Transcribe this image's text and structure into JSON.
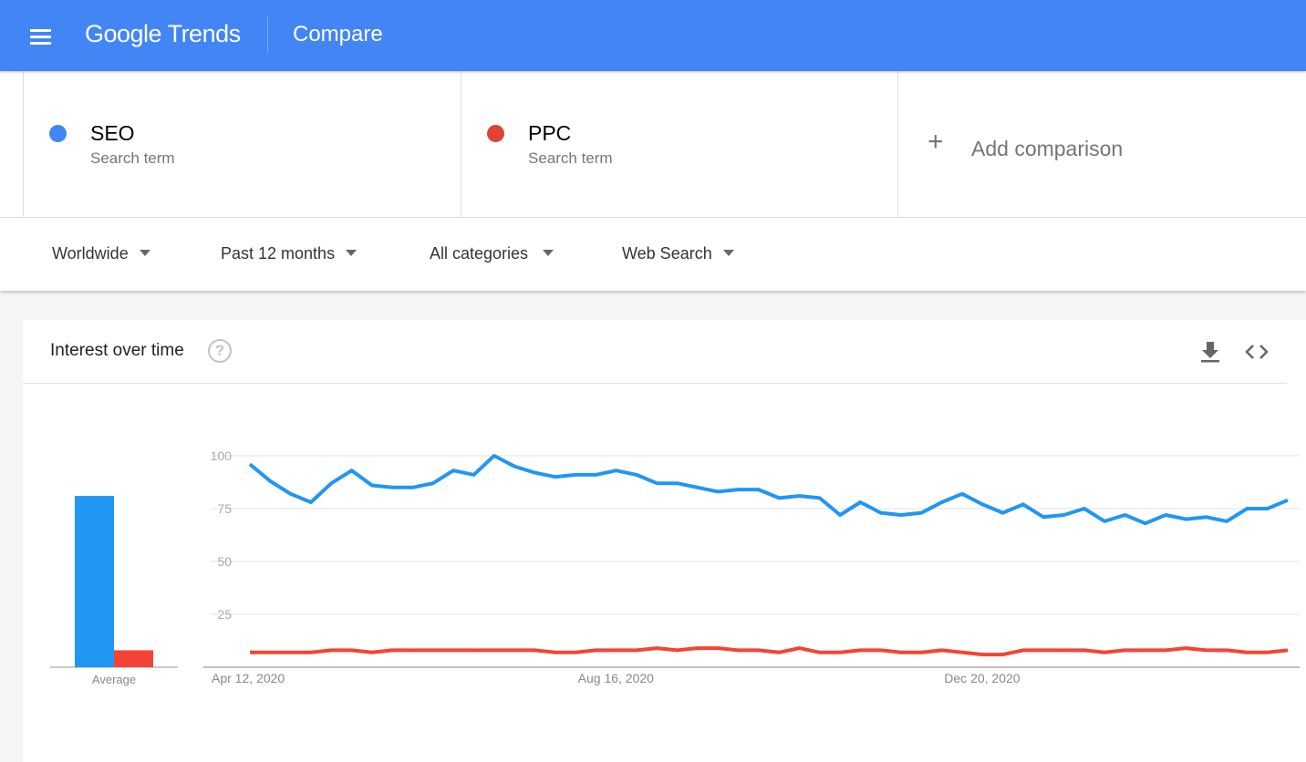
{
  "header": {
    "logo_text": "Google Trends",
    "page_title": "Compare",
    "brand_color": "#4285f4"
  },
  "terms": [
    {
      "name": "SEO",
      "type": "Search term",
      "color": "#4285f4"
    },
    {
      "name": "PPC",
      "type": "Search term",
      "color": "#db4437"
    }
  ],
  "add_comparison": {
    "icon": "plus-icon",
    "label": "Add comparison"
  },
  "filters": [
    {
      "label": "Worldwide"
    },
    {
      "label": "Past 12 months"
    },
    {
      "label": "All categories"
    },
    {
      "label": "Web Search"
    }
  ],
  "card": {
    "title": "Interest over time",
    "help_icon": "help-icon",
    "actions": [
      "download-icon",
      "embed-code-icon"
    ]
  },
  "chart_data": {
    "type": "line",
    "title": "Interest over time",
    "xlabel": "",
    "ylabel": "",
    "ylim": [
      0,
      100
    ],
    "yticks": [
      25,
      50,
      75,
      100
    ],
    "grid": true,
    "x_tick_labels": [
      {
        "index": 0,
        "label": "Apr 12, 2020"
      },
      {
        "index": 18,
        "label": "Aug 16, 2020"
      },
      {
        "index": 36,
        "label": "Dec 20, 2020"
      }
    ],
    "x_start": "Apr 12, 2020",
    "x_interval": "weekly",
    "series": [
      {
        "name": "SEO",
        "color": "#2196f3",
        "values": [
          96,
          88,
          82,
          78,
          87,
          93,
          86,
          85,
          85,
          87,
          93,
          91,
          100,
          95,
          92,
          90,
          91,
          91,
          93,
          91,
          87,
          87,
          85,
          83,
          84,
          84,
          80,
          81,
          80,
          72,
          78,
          73,
          72,
          73,
          78,
          82,
          77,
          73,
          77,
          71,
          72,
          75,
          69,
          72,
          68,
          72,
          70,
          71,
          69,
          75,
          75,
          79
        ]
      },
      {
        "name": "PPC",
        "color": "#f44336",
        "values": [
          7,
          7,
          7,
          7,
          8,
          8,
          7,
          8,
          8,
          8,
          8,
          8,
          8,
          8,
          8,
          7,
          7,
          8,
          8,
          8,
          9,
          8,
          9,
          9,
          8,
          8,
          7,
          9,
          7,
          7,
          8,
          8,
          7,
          7,
          8,
          7,
          6,
          6,
          8,
          8,
          8,
          8,
          7,
          8,
          8,
          8,
          9,
          8,
          8,
          7,
          7,
          8
        ]
      }
    ],
    "average": {
      "label": "Average",
      "values": [
        {
          "name": "SEO",
          "value": 81,
          "color": "#2196f3"
        },
        {
          "name": "PPC",
          "value": 8,
          "color": "#f44336"
        }
      ]
    }
  }
}
